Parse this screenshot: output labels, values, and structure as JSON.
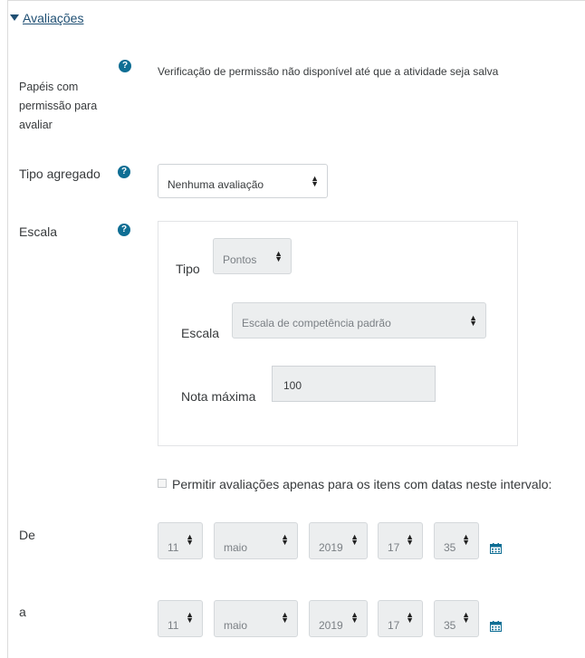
{
  "section": {
    "title": "Avaliações"
  },
  "roles": {
    "label": "Papéis com permissão para avaliar",
    "help": "?",
    "text": "Verificação de permissão não disponível até que a atividade seja salva"
  },
  "aggregate": {
    "label": "Tipo agregado",
    "help": "?",
    "value": "Nenhuma avaliação"
  },
  "scale": {
    "label": "Escala",
    "help": "?",
    "type_label": "Tipo",
    "type_value": "Pontos",
    "scale_label": "Escala",
    "scale_value": "Escala de competência padrão",
    "max_label": "Nota máxima",
    "max_value": "100"
  },
  "restrict": {
    "label": "Permitir avaliações apenas para os itens com datas neste intervalo:"
  },
  "from": {
    "label": "De",
    "day": "11",
    "month": "maio",
    "year": "2019",
    "hour": "17",
    "minute": "35"
  },
  "to": {
    "label": "a",
    "day": "11",
    "month": "maio",
    "year": "2019",
    "hour": "17",
    "minute": "35"
  },
  "icons": {
    "caret": "caret-down-icon",
    "help": "help-icon",
    "calendar": "calendar-icon",
    "select_arrows": "sort-arrows-icon"
  }
}
